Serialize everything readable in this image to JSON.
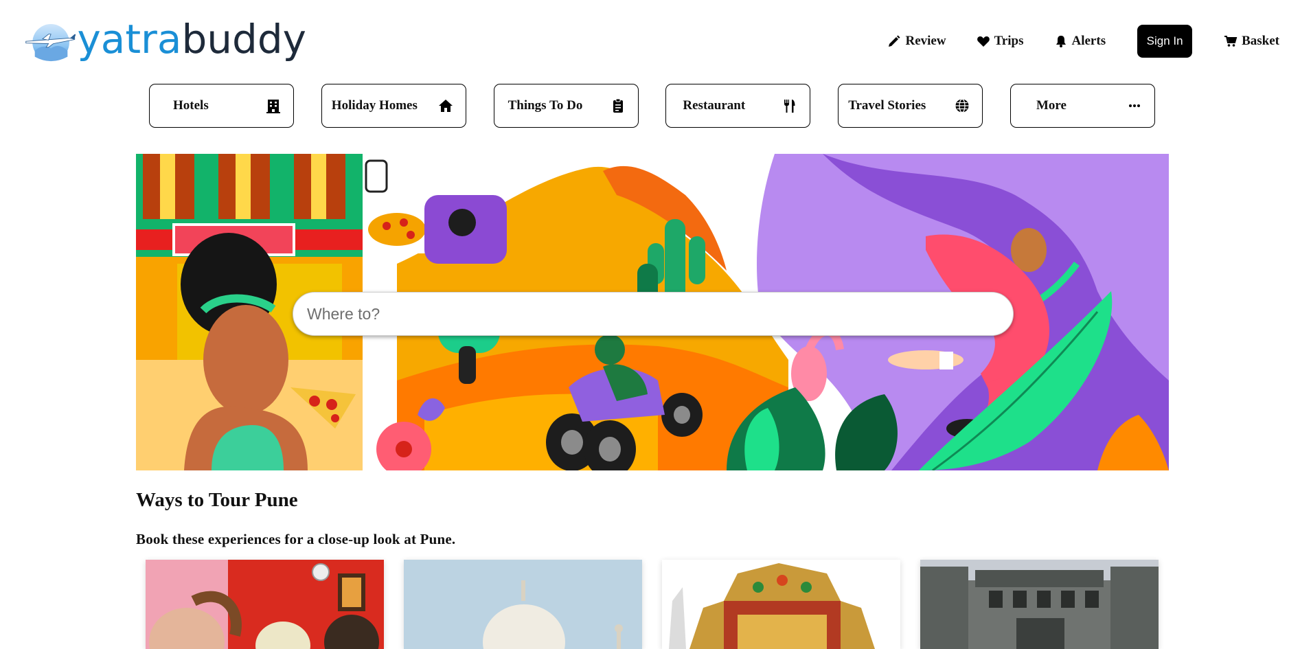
{
  "brand": {
    "name_part1": "yatra",
    "name_part2": "buddy",
    "logo_icon": "airplane-globe-icon",
    "colors": {
      "blue": "#1a8fd6",
      "dark": "#1e2a3a"
    }
  },
  "top_nav": {
    "items": [
      {
        "label": "Review",
        "icon": "pencil-icon"
      },
      {
        "label": "Trips",
        "icon": "heart-icon"
      },
      {
        "label": "Alerts",
        "icon": "bell-icon"
      }
    ],
    "sign_in": "Sign In",
    "basket": {
      "label": "Basket",
      "icon": "cart-icon"
    }
  },
  "categories": [
    {
      "label": "Hotels",
      "icon": "building-icon"
    },
    {
      "label": "Holiday Homes",
      "icon": "house-icon"
    },
    {
      "label": "Things To Do",
      "icon": "clipboard-icon"
    },
    {
      "label": "Restaurant",
      "icon": "fork-knife-icon"
    },
    {
      "label": "Travel Stories",
      "icon": "globe-icon"
    },
    {
      "label": "More",
      "icon": "more-dots-icon"
    }
  ],
  "search": {
    "placeholder": "Where to?",
    "value": ""
  },
  "section": {
    "title": "Ways to Tour Pune",
    "subtitle": "Book these experiences for a close-up look at Pune."
  },
  "experience_cards": [
    {
      "image": "people-festival-photo"
    },
    {
      "image": "taj-mahal-photo"
    },
    {
      "image": "decorated-temple-photo"
    },
    {
      "image": "shaniwar-wada-fort-photo"
    }
  ]
}
